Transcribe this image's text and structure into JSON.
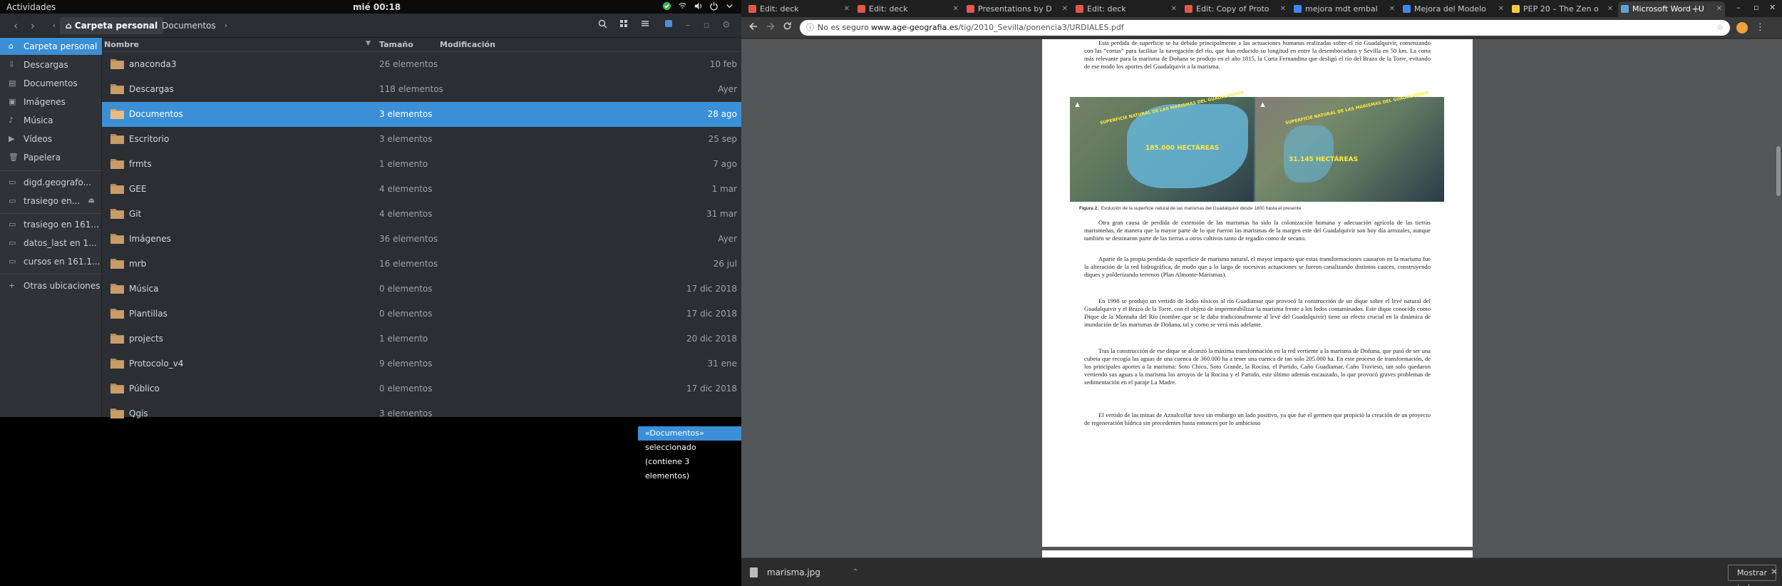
{
  "topbar": {
    "activities": "Actividades",
    "clock": "mié 00:18",
    "tray_icons": [
      "dropbox-icon",
      "network-icon",
      "volume-icon",
      "power-icon",
      "chevron-down-icon"
    ]
  },
  "nautilus": {
    "breadcrumb": {
      "home": "Carpeta personal",
      "current": "Documentos"
    },
    "sidebar": [
      {
        "label": "Carpeta personal",
        "icon": "home-icon",
        "selected": true
      },
      {
        "label": "Descargas",
        "icon": "download-icon"
      },
      {
        "label": "Documentos",
        "icon": "document-icon"
      },
      {
        "label": "Imágenes",
        "icon": "image-icon"
      },
      {
        "label": "Música",
        "icon": "music-icon"
      },
      {
        "label": "Vídeos",
        "icon": "video-icon"
      },
      {
        "label": "Papelera",
        "icon": "trash-icon"
      },
      {
        "label": "digd.geografo...",
        "icon": "network-folder-icon"
      },
      {
        "label": "trasiego en...",
        "icon": "network-folder-icon",
        "eject": true
      },
      {
        "label": "trasiego en 161...",
        "icon": "network-folder-icon"
      },
      {
        "label": "datos_last en 1...",
        "icon": "network-folder-icon"
      },
      {
        "label": "cursos en 161.1...",
        "icon": "network-folder-icon"
      },
      {
        "label": "Otras ubicaciones",
        "icon": "plus-icon"
      }
    ],
    "columns": {
      "name": "Nombre",
      "size": "Tamaño",
      "modified": "Modificación"
    },
    "files": [
      {
        "name": "anaconda3",
        "size": "26 elementos",
        "modified": "10 feb"
      },
      {
        "name": "Descargas",
        "size": "118 elementos",
        "modified": "Ayer"
      },
      {
        "name": "Documentos",
        "size": "3 elementos",
        "modified": "28 ago",
        "selected": true
      },
      {
        "name": "Escritorio",
        "size": "3 elementos",
        "modified": "25 sep"
      },
      {
        "name": "frmts",
        "size": "1 elemento",
        "modified": "7 ago"
      },
      {
        "name": "GEE",
        "size": "4 elementos",
        "modified": "1 mar"
      },
      {
        "name": "Git",
        "size": "4 elementos",
        "modified": "31 mar"
      },
      {
        "name": "Imágenes",
        "size": "36 elementos",
        "modified": "Ayer"
      },
      {
        "name": "mrb",
        "size": "16 elementos",
        "modified": "26 jul"
      },
      {
        "name": "Música",
        "size": "0 elementos",
        "modified": "17 dic 2018"
      },
      {
        "name": "Plantillas",
        "size": "0 elementos",
        "modified": "17 dic 2018"
      },
      {
        "name": "projects",
        "size": "1 elemento",
        "modified": "20 dic 2018"
      },
      {
        "name": "Protocolo_v4",
        "size": "9 elementos",
        "modified": "31 ene"
      },
      {
        "name": "Público",
        "size": "0 elementos",
        "modified": "17 dic 2018"
      },
      {
        "name": "Qgis",
        "size": "3 elementos",
        "modified": ""
      }
    ],
    "status": "«Documentos» seleccionado  (contiene 3 elementos)"
  },
  "chrome": {
    "tabs": [
      {
        "title": "Edit: deck",
        "color": "#e2574c"
      },
      {
        "title": "Edit: deck",
        "color": "#e2574c"
      },
      {
        "title": "Presentations by D",
        "color": "#e2574c"
      },
      {
        "title": "Edit: deck",
        "color": "#e2574c"
      },
      {
        "title": "Edit: Copy of Proto",
        "color": "#e2574c"
      },
      {
        "title": "mejora mdt embal",
        "color": "#4285f4"
      },
      {
        "title": "Mejora del Modelo",
        "color": "#4285f4"
      },
      {
        "title": "PEP 20 – The Zen o",
        "color": "#f7c948"
      },
      {
        "title": "Microsoft Word - U",
        "color": "#5ba4d9",
        "active": true
      }
    ],
    "omnibox": {
      "security": "No es seguro",
      "host": "www.age-geografia.es",
      "path": "/tig/2010_Sevilla/ponencia3/URDIALES.pdf"
    },
    "pdf": {
      "para1": "Esta perdida de superficie se ha debido principalmente a las actuaciones humanas realizadas sobre el río Guadalquivir, comenzando con las “cortas” para facilitar la navegación del río, que han reducido su longitud en  entre la desembocadura y Sevilla en 50 km. La corta más relevante para la marisma de Doñana se produjo en el año 1815, la Corta Fernandina que desligó el río del Brazo de la Torre, evitando de ese modo los aportes del Guadalquivir a la marisma.",
      "figure_left_label": "185.000 HECTÁREAS",
      "figure_right_label": "31.145 HECTÁREAS",
      "figure_left_title": "SUPERFICIE NATURAL DE LAS MARISMAS DEL GUADALQUIVIR",
      "figure_right_title": "SUPERFICIE NATURAL DE LAS MARISMAS DEL GUADALQUIVIR",
      "caption_label": "Figura 2.",
      "caption": "Evolución de la superficie natural de las marismas del Guadalquivir desde 1800 hasta el presente",
      "para2": "Otra gran causa de perdida de extensión de las marismas ha sido la colonización humana y adecuación agrícola de las tierras marismeñas, de manera que la mayor parte de lo que fueron las marismas de la margen este del Guadalquivir son hoy día arrozales, aunque también se destinaron parte de las tierras a otros cultivos tanto de regadío como de secano.",
      "para3": "Aparte de la propia perdida de superficie de marisma natural, el mayor impacto que estas transformaciones causaron en la marisma fue la alteración de la red hidrográfica, de modo que a lo largo de sucesivas actuaciones se fueron canalizando distintos cauces, construyendo diques y polderizando terrenos (Plan Almonte-Marismas).",
      "para4": "En 1998 se produjo un vertido de lodos tóxicos al río Guadiamar que provocó la construcción de un dique sobre el levé natural del Guadalquivir y el Brazo de la Torre, con el objeto de impermeabilizar la marisma frente a los lodos contaminados. Este dique conocido como Dique de la Montaña del Río (nombre que se le daba tradicionalmente al levé del Guadalquivir) tiene un efecto crucial en la dinámica de inundación de las marismas de Doñana, tal y como se verá más adelante.",
      "para5": "Tras la construcción de ese dique se alcanzó la máxima transformación en la red vertiente a la marisma de Doñana, que pasó de ser una cubeta que recogía las aguas de una cuenca de 360.000 ha a tener una cuenca de tan solo 205.000 ha. En este proceso de transformación, de los principales aportes a la marisma: Soto Chico, Soto Grande, la Rocina, el Partido, Caño Guadiamar, Caño Travieso, tan solo quedaron vertiendo sus aguas a la marisma los arroyos de la Rocina y el Partido, este último además encauzado, lo que provocó graves problemas de sedimentación en el paraje La Madre.",
      "para6": "El vertido de las minas de Aznalcollar tuvo sin embargo un lado positivo, ya que fue el germen que propició la creación de un proyecto de regeneración hídrica sin precedentes hasta entonces por lo ambicioso"
    },
    "download": {
      "filename": "marisma.jpg",
      "show_all": "Mostrar todo"
    }
  }
}
